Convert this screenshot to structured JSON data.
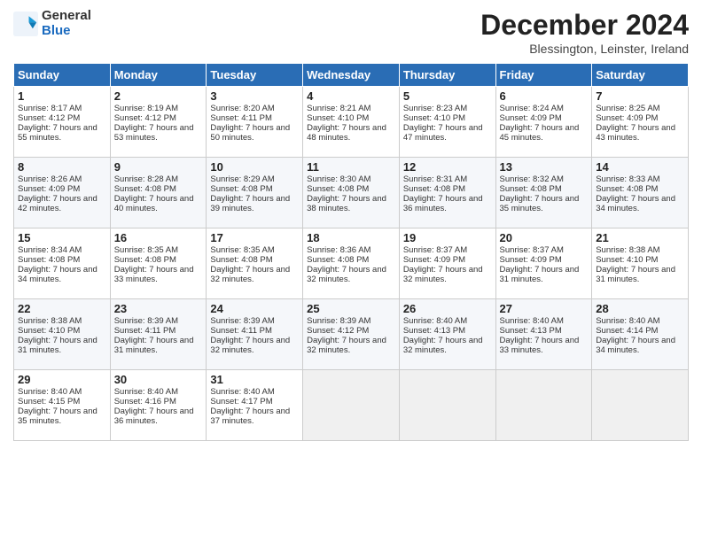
{
  "logo": {
    "general": "General",
    "blue": "Blue"
  },
  "title": "December 2024",
  "location": "Blessington, Leinster, Ireland",
  "headers": [
    "Sunday",
    "Monday",
    "Tuesday",
    "Wednesday",
    "Thursday",
    "Friday",
    "Saturday"
  ],
  "weeks": [
    [
      {
        "day": "1",
        "sunrise": "Sunrise: 8:17 AM",
        "sunset": "Sunset: 4:12 PM",
        "daylight": "Daylight: 7 hours and 55 minutes."
      },
      {
        "day": "2",
        "sunrise": "Sunrise: 8:19 AM",
        "sunset": "Sunset: 4:12 PM",
        "daylight": "Daylight: 7 hours and 53 minutes."
      },
      {
        "day": "3",
        "sunrise": "Sunrise: 8:20 AM",
        "sunset": "Sunset: 4:11 PM",
        "daylight": "Daylight: 7 hours and 50 minutes."
      },
      {
        "day": "4",
        "sunrise": "Sunrise: 8:21 AM",
        "sunset": "Sunset: 4:10 PM",
        "daylight": "Daylight: 7 hours and 48 minutes."
      },
      {
        "day": "5",
        "sunrise": "Sunrise: 8:23 AM",
        "sunset": "Sunset: 4:10 PM",
        "daylight": "Daylight: 7 hours and 47 minutes."
      },
      {
        "day": "6",
        "sunrise": "Sunrise: 8:24 AM",
        "sunset": "Sunset: 4:09 PM",
        "daylight": "Daylight: 7 hours and 45 minutes."
      },
      {
        "day": "7",
        "sunrise": "Sunrise: 8:25 AM",
        "sunset": "Sunset: 4:09 PM",
        "daylight": "Daylight: 7 hours and 43 minutes."
      }
    ],
    [
      {
        "day": "8",
        "sunrise": "Sunrise: 8:26 AM",
        "sunset": "Sunset: 4:09 PM",
        "daylight": "Daylight: 7 hours and 42 minutes."
      },
      {
        "day": "9",
        "sunrise": "Sunrise: 8:28 AM",
        "sunset": "Sunset: 4:08 PM",
        "daylight": "Daylight: 7 hours and 40 minutes."
      },
      {
        "day": "10",
        "sunrise": "Sunrise: 8:29 AM",
        "sunset": "Sunset: 4:08 PM",
        "daylight": "Daylight: 7 hours and 39 minutes."
      },
      {
        "day": "11",
        "sunrise": "Sunrise: 8:30 AM",
        "sunset": "Sunset: 4:08 PM",
        "daylight": "Daylight: 7 hours and 38 minutes."
      },
      {
        "day": "12",
        "sunrise": "Sunrise: 8:31 AM",
        "sunset": "Sunset: 4:08 PM",
        "daylight": "Daylight: 7 hours and 36 minutes."
      },
      {
        "day": "13",
        "sunrise": "Sunrise: 8:32 AM",
        "sunset": "Sunset: 4:08 PM",
        "daylight": "Daylight: 7 hours and 35 minutes."
      },
      {
        "day": "14",
        "sunrise": "Sunrise: 8:33 AM",
        "sunset": "Sunset: 4:08 PM",
        "daylight": "Daylight: 7 hours and 34 minutes."
      }
    ],
    [
      {
        "day": "15",
        "sunrise": "Sunrise: 8:34 AM",
        "sunset": "Sunset: 4:08 PM",
        "daylight": "Daylight: 7 hours and 34 minutes."
      },
      {
        "day": "16",
        "sunrise": "Sunrise: 8:35 AM",
        "sunset": "Sunset: 4:08 PM",
        "daylight": "Daylight: 7 hours and 33 minutes."
      },
      {
        "day": "17",
        "sunrise": "Sunrise: 8:35 AM",
        "sunset": "Sunset: 4:08 PM",
        "daylight": "Daylight: 7 hours and 32 minutes."
      },
      {
        "day": "18",
        "sunrise": "Sunrise: 8:36 AM",
        "sunset": "Sunset: 4:08 PM",
        "daylight": "Daylight: 7 hours and 32 minutes."
      },
      {
        "day": "19",
        "sunrise": "Sunrise: 8:37 AM",
        "sunset": "Sunset: 4:09 PM",
        "daylight": "Daylight: 7 hours and 32 minutes."
      },
      {
        "day": "20",
        "sunrise": "Sunrise: 8:37 AM",
        "sunset": "Sunset: 4:09 PM",
        "daylight": "Daylight: 7 hours and 31 minutes."
      },
      {
        "day": "21",
        "sunrise": "Sunrise: 8:38 AM",
        "sunset": "Sunset: 4:10 PM",
        "daylight": "Daylight: 7 hours and 31 minutes."
      }
    ],
    [
      {
        "day": "22",
        "sunrise": "Sunrise: 8:38 AM",
        "sunset": "Sunset: 4:10 PM",
        "daylight": "Daylight: 7 hours and 31 minutes."
      },
      {
        "day": "23",
        "sunrise": "Sunrise: 8:39 AM",
        "sunset": "Sunset: 4:11 PM",
        "daylight": "Daylight: 7 hours and 31 minutes."
      },
      {
        "day": "24",
        "sunrise": "Sunrise: 8:39 AM",
        "sunset": "Sunset: 4:11 PM",
        "daylight": "Daylight: 7 hours and 32 minutes."
      },
      {
        "day": "25",
        "sunrise": "Sunrise: 8:39 AM",
        "sunset": "Sunset: 4:12 PM",
        "daylight": "Daylight: 7 hours and 32 minutes."
      },
      {
        "day": "26",
        "sunrise": "Sunrise: 8:40 AM",
        "sunset": "Sunset: 4:13 PM",
        "daylight": "Daylight: 7 hours and 32 minutes."
      },
      {
        "day": "27",
        "sunrise": "Sunrise: 8:40 AM",
        "sunset": "Sunset: 4:13 PM",
        "daylight": "Daylight: 7 hours and 33 minutes."
      },
      {
        "day": "28",
        "sunrise": "Sunrise: 8:40 AM",
        "sunset": "Sunset: 4:14 PM",
        "daylight": "Daylight: 7 hours and 34 minutes."
      }
    ],
    [
      {
        "day": "29",
        "sunrise": "Sunrise: 8:40 AM",
        "sunset": "Sunset: 4:15 PM",
        "daylight": "Daylight: 7 hours and 35 minutes."
      },
      {
        "day": "30",
        "sunrise": "Sunrise: 8:40 AM",
        "sunset": "Sunset: 4:16 PM",
        "daylight": "Daylight: 7 hours and 36 minutes."
      },
      {
        "day": "31",
        "sunrise": "Sunrise: 8:40 AM",
        "sunset": "Sunset: 4:17 PM",
        "daylight": "Daylight: 7 hours and 37 minutes."
      },
      null,
      null,
      null,
      null
    ]
  ]
}
